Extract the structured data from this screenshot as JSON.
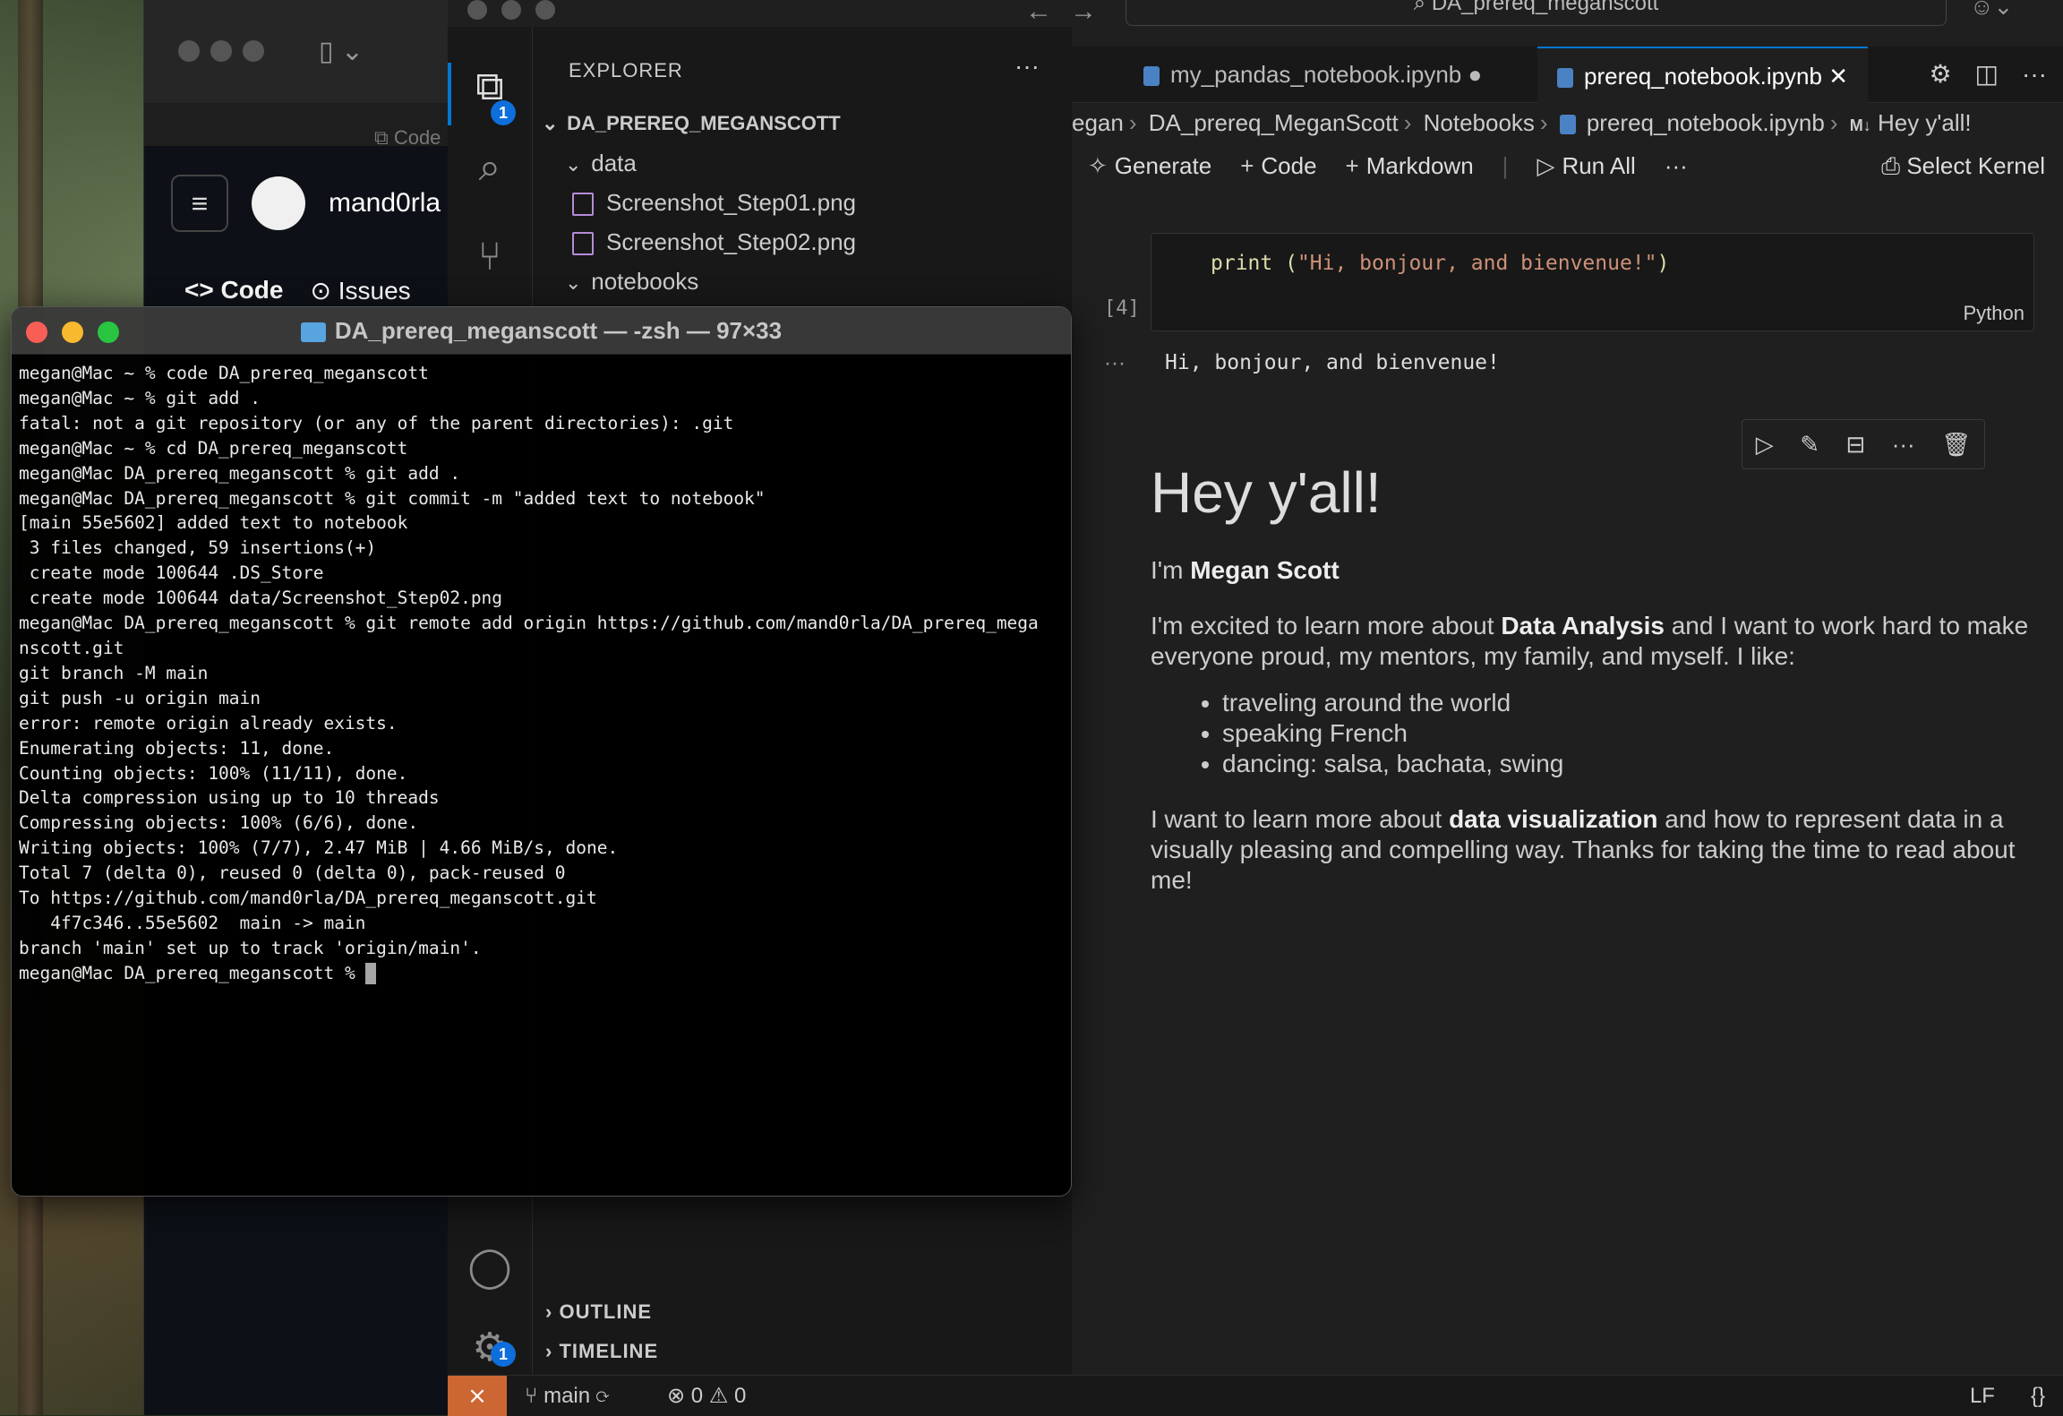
{
  "browser": {
    "tab_label": "Code",
    "user": "mand0rla",
    "tabs": [
      "Code",
      "Issues"
    ]
  },
  "vscode": {
    "search": "DA_prereq_meganscott",
    "explorer": {
      "title": "EXPLORER",
      "root": "DA_PREREQ_MEGANSCOTT",
      "folders": [
        "data",
        "notebooks"
      ],
      "files": [
        "Screenshot_Step01.png",
        "Screenshot_Step02.png"
      ],
      "outline": "OUTLINE",
      "timeline": "TIMELINE"
    },
    "badges": {
      "explorer": "1",
      "settings": "1"
    },
    "tabs": [
      {
        "label": "my_pandas_notebook.ipynb",
        "dirty": true
      },
      {
        "label": "prereq_notebook.ipynb",
        "active": true
      }
    ],
    "breadcrumbs": [
      "egan",
      "DA_prereq_MeganScott",
      "Notebooks",
      "prereq_notebook.ipynb",
      "Hey y'all!"
    ],
    "toolbar": {
      "generate": "Generate",
      "code": "Code",
      "markdown": "Markdown",
      "run_all": "Run All",
      "select_kernel": "Select Kernel"
    },
    "cell": {
      "code_prefix": "print (",
      "code_string": "\"Hi, bonjour, and bienvenue!\"",
      "code_suffix": ")",
      "language": "Python",
      "exec_count": "[4]",
      "output": "Hi, bonjour, and bienvenue!"
    },
    "markdown": {
      "heading": "Hey y'all!",
      "intro_prefix": "I'm ",
      "name": "Megan Scott",
      "p1_a": "I'm excited to learn more about ",
      "p1_bold": "Data Analysis",
      "p1_b": " and I want to work hard to make everyone proud, my mentors, my family, and myself. I like:",
      "likes": [
        "traveling around the world",
        "speaking French",
        "dancing: salsa, bachata, swing"
      ],
      "p2_a": "I want to learn more about ",
      "p2_bold": "data visualization",
      "p2_b": " and how to represent data in a visually pleasing and compelling way. Thanks for taking the time to read about me!"
    },
    "status": {
      "branch": "main",
      "errors": "0",
      "warnings": "0",
      "eol": "LF",
      "lang_icon": "{}"
    }
  },
  "terminal": {
    "title": "DA_prereq_meganscott — -zsh — 97×33",
    "lines": [
      "megan@Mac ~ % code DA_prereq_meganscott",
      "megan@Mac ~ % git add .",
      "fatal: not a git repository (or any of the parent directories): .git",
      "megan@Mac ~ % cd DA_prereq_meganscott",
      "megan@Mac DA_prereq_meganscott % git add .",
      "megan@Mac DA_prereq_meganscott % git commit -m \"added text to notebook\"",
      "[main 55e5602] added text to notebook",
      " 3 files changed, 59 insertions(+)",
      " create mode 100644 .DS_Store",
      " create mode 100644 data/Screenshot_Step02.png",
      "megan@Mac DA_prereq_meganscott % git remote add origin https://github.com/mand0rla/DA_prereq_mega",
      "nscott.git",
      "git branch -M main",
      "git push -u origin main",
      "error: remote origin already exists.",
      "Enumerating objects: 11, done.",
      "Counting objects: 100% (11/11), done.",
      "Delta compression using up to 10 threads",
      "Compressing objects: 100% (6/6), done.",
      "Writing objects: 100% (7/7), 2.47 MiB | 4.66 MiB/s, done.",
      "Total 7 (delta 0), reused 0 (delta 0), pack-reused 0",
      "To https://github.com/mand0rla/DA_prereq_meganscott.git",
      "   4f7c346..55e5602  main -> main",
      "branch 'main' set up to track 'origin/main'.",
      "megan@Mac DA_prereq_meganscott % "
    ]
  },
  "colors": {
    "accent": "#0078d4",
    "remote": "#cc6633",
    "close": "#ff5f57",
    "minimize": "#febc2e",
    "zoom": "#28c840"
  }
}
